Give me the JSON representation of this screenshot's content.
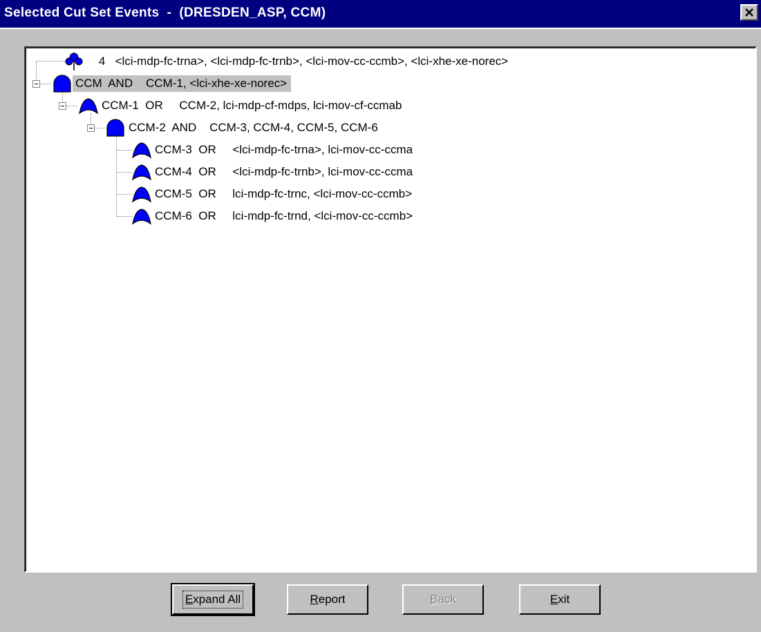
{
  "window": {
    "title": "Selected Cut Set Events  -  (DRESDEN_ASP, CCM)",
    "close_glyph": "✕"
  },
  "tree": {
    "nodes": [
      {
        "icon": "cutset-icon",
        "text": "    4   <lci-mdp-fc-trna>, <lci-mdp-fc-trnb>, <lci-mov-cc-ccmb>, <lci-xhe-xe-norec>"
      },
      {
        "icon": "and-gate-icon",
        "text": "CCM  AND    CCM-1, <lci-xhe-xe-norec>"
      },
      {
        "icon": "or-gate-icon",
        "text": "CCM-1  OR     CCM-2, lci-mdp-cf-mdps, lci-mov-cf-ccmab"
      },
      {
        "icon": "and-gate-icon",
        "text": "CCM-2  AND    CCM-3, CCM-4, CCM-5, CCM-6"
      },
      {
        "icon": "or-gate-icon",
        "text": "CCM-3  OR     <lci-mdp-fc-trna>, lci-mov-cc-ccma"
      },
      {
        "icon": "or-gate-icon",
        "text": "CCM-4  OR     <lci-mdp-fc-trnb>, lci-mov-cc-ccma"
      },
      {
        "icon": "or-gate-icon",
        "text": "CCM-5  OR     lci-mdp-fc-trnc, <lci-mov-cc-ccmb>"
      },
      {
        "icon": "or-gate-icon",
        "text": "CCM-6  OR     lci-mdp-fc-trnd, <lci-mov-cc-ccmb>"
      }
    ]
  },
  "buttons": {
    "expand_all": {
      "pre": "",
      "key": "E",
      "post": "xpand All"
    },
    "report": {
      "pre": "",
      "key": "R",
      "post": "eport"
    },
    "back": {
      "pre": "",
      "key": "B",
      "post": "ack"
    },
    "exit": {
      "pre": "",
      "key": "E",
      "post": "xit"
    }
  },
  "colors": {
    "titlebar": "#000080",
    "gate_fill": "#0000ff",
    "selection": "#c0c0c0"
  }
}
